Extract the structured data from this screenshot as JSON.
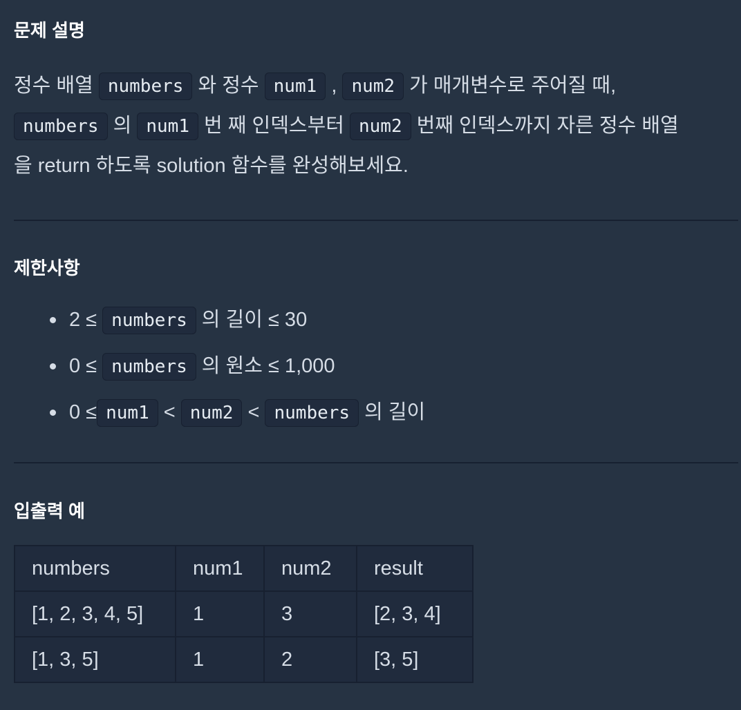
{
  "description": {
    "title": "문제 설명",
    "t1": "정수 배열 ",
    "c_numbers": "numbers",
    "t2": " 와 정수 ",
    "c_num1": "num1",
    "t3": " , ",
    "c_num2": "num2",
    "t4": " 가 매개변수로 주어질 때,",
    "t5": " 의 ",
    "t6": " 번 째 인덱스부터 ",
    "t7": " 번째 인덱스까지 자른 정수 배열",
    "t8": "을 return 하도록 solution 함수를 완성해보세요."
  },
  "limits": {
    "title": "제한사항",
    "items": [
      {
        "pre": "2 ≤ ",
        "code": "numbers",
        "post": " 의 길이 ≤ 30"
      },
      {
        "pre": "0 ≤ ",
        "code": "numbers",
        "post": " 의 원소 ≤ 1,000"
      },
      {
        "pre": "0 ≤",
        "code1": "num1",
        "mid1": " < ",
        "code2": "num2",
        "mid2": " < ",
        "code3": "numbers",
        "post": " 의 길이"
      }
    ]
  },
  "io": {
    "title": "입출력 예",
    "headers": [
      "numbers",
      "num1",
      "num2",
      "result"
    ],
    "rows": [
      [
        "[1, 2, 3, 4, 5]",
        "1",
        "3",
        "[2, 3, 4]"
      ],
      [
        "[1, 3, 5]",
        "1",
        "2",
        "[3, 5]"
      ]
    ]
  },
  "colors": {
    "background": "#263343",
    "code_background": "#202b3d",
    "border": "#172030",
    "text": "#d6dde6",
    "heading": "#ffffff"
  }
}
